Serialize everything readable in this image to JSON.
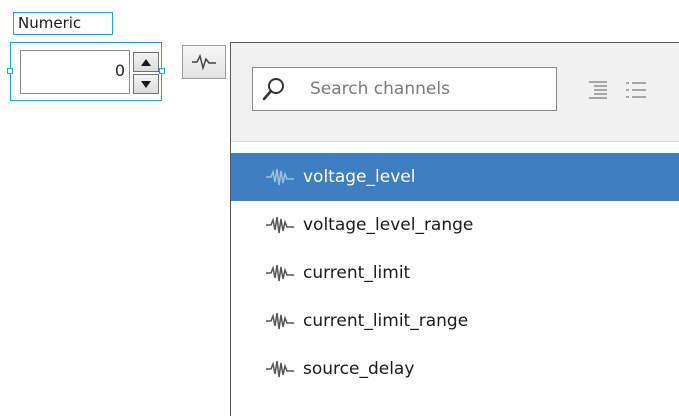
{
  "numeric": {
    "label": "Numeric",
    "value": "0"
  },
  "channel_picker": {
    "search": {
      "placeholder": "Search channels"
    },
    "icons": [
      "search-icon",
      "list-view-icon",
      "detail-view-icon",
      "waveform-icon"
    ],
    "items": [
      {
        "label": "voltage_level",
        "selected": true
      },
      {
        "label": "voltage_level_range",
        "selected": false
      },
      {
        "label": "current_limit",
        "selected": false
      },
      {
        "label": "current_limit_range",
        "selected": false
      },
      {
        "label": "source_delay",
        "selected": false
      }
    ],
    "colors": {
      "selection": "#3d7fc0",
      "accent_border": "#1ea3d9",
      "header_bg": "#f1f1f1"
    }
  }
}
